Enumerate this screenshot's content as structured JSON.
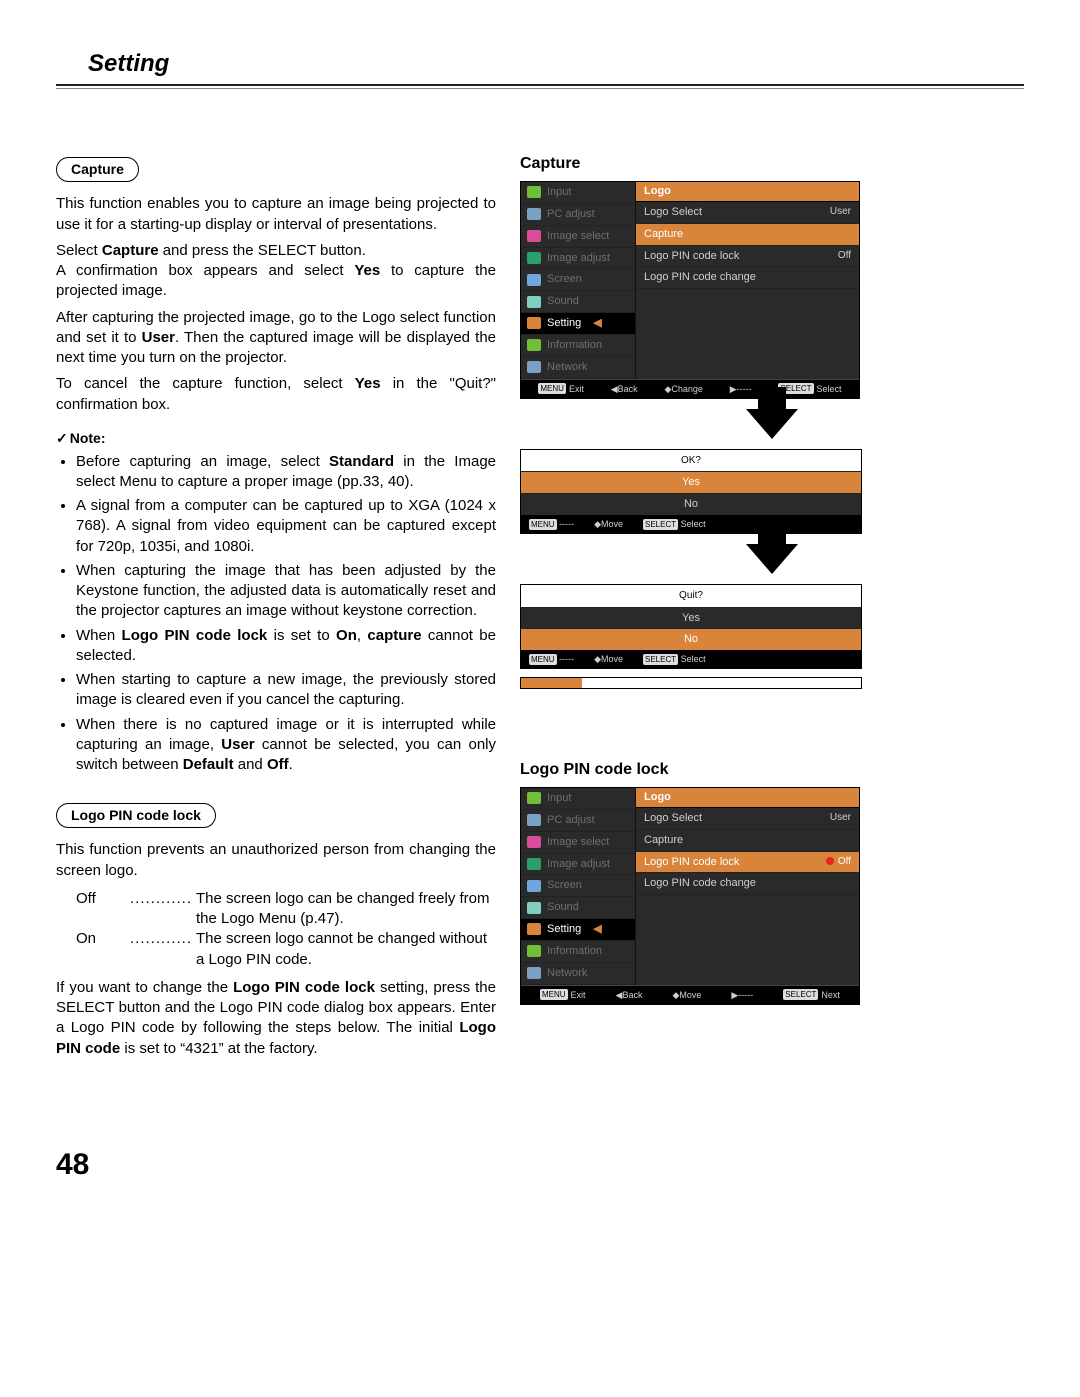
{
  "page": {
    "title": "Setting",
    "number": "48"
  },
  "capture": {
    "pill": "Capture",
    "p1": "This function enables you to capture an image being projected to use it for a starting-up display or interval of presentations.",
    "p2a": "Select ",
    "p2b": "Capture",
    "p2c": " and press the SELECT button.",
    "p3a": "A confirmation box appears and select ",
    "p3b": "Yes",
    "p3c": " to capture the projected image.",
    "p4a": "After capturing the projected image, go to the Logo select function and set it to ",
    "p4b": "User",
    "p4c": ". Then the captured image will be displayed the next time you turn on the projector.",
    "p5a": "To cancel the capture function, select ",
    "p5b": "Yes",
    "p5c": " in the \"Quit?\" confirmation box.",
    "noteHead": "Note:",
    "n1a": "Before capturing an image, select ",
    "n1b": "Standard",
    "n1c": " in the Image select Menu to capture a proper image (pp.33, 40).",
    "n2": "A signal from a computer can be captured up to XGA (1024 x 768). A signal from video equipment can be captured except for 720p, 1035i, and 1080i.",
    "n3": "When capturing the image that has been adjusted by the Keystone function, the adjusted data is automatically reset and the projector captures an image without keystone correction.",
    "n4a": "When ",
    "n4b": "Logo PIN code lock",
    "n4c": " is set to ",
    "n4d": "On",
    "n4e": ", ",
    "n4f": "capture",
    "n4g": " cannot be selected.",
    "n5": "When starting to capture a new image, the previously stored image is cleared even if you cancel the capturing.",
    "n6a": "When there is no captured image or it is interrupted while capturing an image, ",
    "n6b": "User",
    "n6c": " cannot be selected, you can only switch between ",
    "n6d": "Default",
    "n6e": " and ",
    "n6f": "Off",
    "n6g": "."
  },
  "pinlock": {
    "pill": "Logo PIN code lock",
    "p1": "This function prevents an unauthorized person from changing the screen logo.",
    "offKey": "Off",
    "offVal": "The screen logo can be changed freely from the Logo Menu (p.47).",
    "onKey": "On",
    "onVal": "The screen logo cannot be changed without a Logo PIN code.",
    "p2a": "If you want to change the ",
    "p2b": "Logo PIN code lock",
    "p2c": " setting, press the SELECT button and the Logo PIN code dialog box appears. Enter a Logo PIN code by following the steps below. The initial ",
    "p2d": "Logo PIN code",
    "p2e": " is set to “4321” at the factory."
  },
  "fig1": {
    "title": "Capture",
    "side": [
      "Input",
      "PC adjust",
      "Image select",
      "Image adjust",
      "Screen",
      "Sound",
      "Setting",
      "Information",
      "Network"
    ],
    "panelHead": "Logo",
    "items": [
      {
        "label": "Logo Select",
        "val": "User"
      },
      {
        "label": "Capture",
        "val": "",
        "sel": true
      },
      {
        "label": "Logo PIN code lock",
        "val": "Off"
      },
      {
        "label": "Logo PIN code change",
        "val": ""
      }
    ],
    "foot": [
      "MENU Exit",
      "◀Back",
      "◆Change",
      "▶-----",
      "SELECT Select"
    ]
  },
  "dlg1": {
    "prompt": "OK?",
    "opts": [
      {
        "t": "Yes",
        "sel": true
      },
      {
        "t": "No"
      }
    ],
    "foot": [
      "MENU -----",
      "◆Move",
      "SELECT Select"
    ]
  },
  "dlg2": {
    "prompt": "Quit?",
    "opts": [
      {
        "t": "Yes"
      },
      {
        "t": "No",
        "sel": true
      }
    ],
    "foot": [
      "MENU -----",
      "◆Move",
      "SELECT Select"
    ]
  },
  "fig2": {
    "title": "Logo PIN code lock",
    "side": [
      "Input",
      "PC adjust",
      "Image select",
      "Image adjust",
      "Screen",
      "Sound",
      "Setting",
      "Information",
      "Network"
    ],
    "panelHead": "Logo",
    "items": [
      {
        "label": "Logo Select",
        "val": "User"
      },
      {
        "label": "Capture",
        "val": ""
      },
      {
        "label": "Logo PIN code lock",
        "val": "Off",
        "sel": true,
        "lock": true
      },
      {
        "label": "Logo PIN code change",
        "val": ""
      }
    ],
    "foot": [
      "MENU Exit",
      "◀Back",
      "◆Move",
      "▶-----",
      "SELECT Next"
    ]
  },
  "iconColors": [
    "#6fbf3a",
    "#7aa0c4",
    "#d94b9b",
    "#2aa06f",
    "#6fa7d9",
    "#7fd0c0",
    "#d9843b",
    "#6fbf3a",
    "#7aa0c4"
  ]
}
